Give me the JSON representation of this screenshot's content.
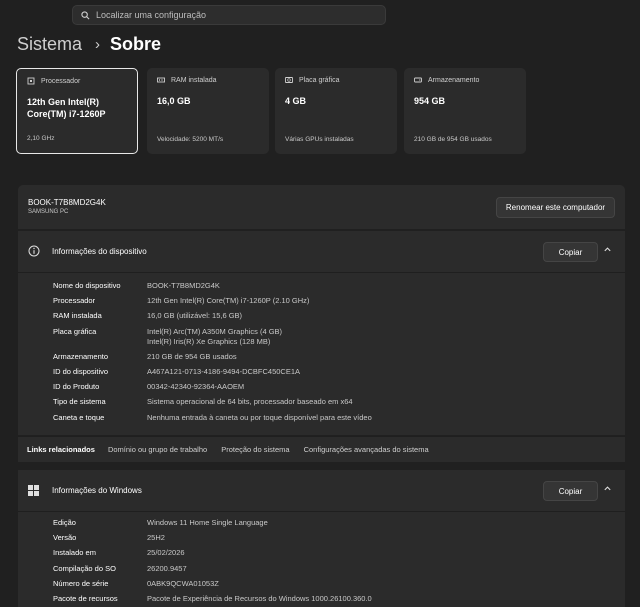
{
  "search": {
    "placeholder": "Localizar uma configuração"
  },
  "breadcrumb": {
    "parent": "Sistema",
    "separator": "›",
    "current": "Sobre"
  },
  "specs": [
    {
      "label": "Processador",
      "value_line1": "12th Gen Intel(R)",
      "value_line2": "Core(TM) i7-1260P",
      "sub": "2,10 GHz",
      "icon": "processor-icon"
    },
    {
      "label": "RAM instalada",
      "value_line1": "16,0 GB",
      "value_line2": "",
      "sub": "Velocidade: 5200 MT/s",
      "icon": "ram-icon"
    },
    {
      "label": "Placa gráfica",
      "value_line1": "4 GB",
      "value_line2": "",
      "sub": "Várias GPUs instaladas",
      "icon": "gpu-icon"
    },
    {
      "label": "Armazenamento",
      "value_line1": "954 GB",
      "value_line2": "",
      "sub": "210 GB de 954 GB usados",
      "icon": "storage-icon"
    }
  ],
  "device": {
    "name": "BOOK-T7B8MD2G4K",
    "maker": "SAMSUNG PC",
    "rename_label": "Renomear este computador"
  },
  "device_info": {
    "title": "Informações do dispositivo",
    "copy_label": "Copiar",
    "rows": [
      {
        "k": "Nome do dispositivo",
        "v": "BOOK-T7B8MD2G4K"
      },
      {
        "k": "Processador",
        "v": "12th Gen Intel(R) Core(TM) i7-1260P (2.10 GHz)"
      },
      {
        "k": "RAM instalada",
        "v": "16,0 GB (utilizável: 15,6 GB)"
      },
      {
        "k": "Placa gráfica",
        "v": "Intel(R) Arc(TM) A350M Graphics (4 GB)",
        "v2": "Intel(R) Iris(R) Xe Graphics (128 MB)"
      },
      {
        "k": "Armazenamento",
        "v": "210 GB de 954 GB usados"
      },
      {
        "k": "ID do dispositivo",
        "v": "A467A121-0713-4186-9494-DCBFC450CE1A"
      },
      {
        "k": "ID do Produto",
        "v": "00342-42340-92364-AAOEM"
      },
      {
        "k": "Tipo de sistema",
        "v": "Sistema operacional de 64 bits, processador baseado em x64"
      },
      {
        "k": "Caneta e toque",
        "v": "Nenhuma entrada à caneta ou por toque disponível para este vídeo"
      }
    ]
  },
  "related": {
    "label": "Links relacionados",
    "links": [
      "Domínio ou grupo de trabalho",
      "Proteção do sistema",
      "Configurações avançadas do sistema"
    ]
  },
  "windows_info": {
    "title": "Informações do Windows",
    "copy_label": "Copiar",
    "rows": [
      {
        "k": "Edição",
        "v": "Windows 11 Home Single Language"
      },
      {
        "k": "Versão",
        "v": "25H2"
      },
      {
        "k": "Instalado em",
        "v": "25/02/2026"
      },
      {
        "k": "Compilação do SO",
        "v": "26200.9457"
      },
      {
        "k": "Número de série",
        "v": "0ABK9QCWA01053Z"
      },
      {
        "k": "Pacote de recursos",
        "v": "Pacote de Experiência de Recursos do Windows 1000.26100.360.0"
      }
    ]
  }
}
